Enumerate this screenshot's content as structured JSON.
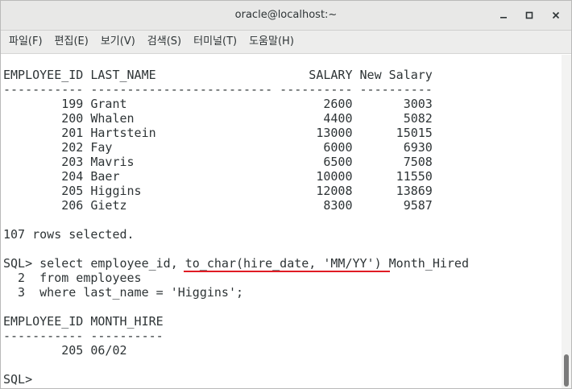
{
  "window": {
    "title": "oracle@localhost:~",
    "minimize_icon": "minimize-icon",
    "maximize_icon": "maximize-icon",
    "close_icon": "close-icon"
  },
  "menu": [
    {
      "label": "파일(F)"
    },
    {
      "label": "편집(E)"
    },
    {
      "label": "보기(V)"
    },
    {
      "label": "검색(S)"
    },
    {
      "label": "터미널(T)"
    },
    {
      "label": "도움말(H)"
    }
  ],
  "terminal": {
    "lines": [
      "EMPLOYEE_ID LAST_NAME                     SALARY New Salary",
      "----------- ------------------------- ---------- ----------",
      "        199 Grant                           2600       3003",
      "        200 Whalen                          4400       5082",
      "        201 Hartstein                      13000      15015",
      "        202 Fay                             6000       6930",
      "        203 Mavris                          6500       7508",
      "        204 Baer                           10000      11550",
      "        205 Higgins                        12008      13869",
      "        206 Gietz                           8300       9587",
      "",
      "107 rows selected.",
      "",
      "SQL> select employee_id, to_char(hire_date, 'MM/YY') Month_Hired",
      "  2  from employees",
      "  3  where last_name = 'Higgins';",
      "",
      "EMPLOYEE_ID MONTH_HIRE",
      "----------- ----------",
      "        205 06/02",
      "",
      "SQL>"
    ],
    "highlight_color": "#e01b24"
  }
}
